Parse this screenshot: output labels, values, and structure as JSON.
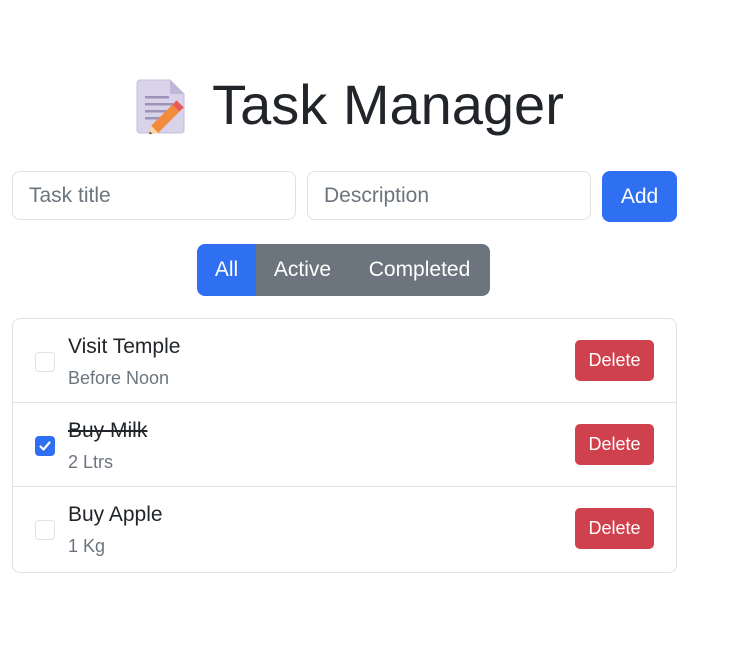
{
  "header": {
    "icon": "memo-icon",
    "title": "Task Manager"
  },
  "form": {
    "title_placeholder": "Task title",
    "description_placeholder": "Description",
    "add_label": "Add"
  },
  "filters": [
    {
      "label": "All",
      "active": true
    },
    {
      "label": "Active",
      "active": false
    },
    {
      "label": "Completed",
      "active": false
    }
  ],
  "tasks": [
    {
      "title": "Visit Temple",
      "description": "Before Noon",
      "completed": false,
      "delete_label": "Delete"
    },
    {
      "title": "Buy Milk",
      "description": "2 Ltrs",
      "completed": true,
      "delete_label": "Delete"
    },
    {
      "title": "Buy Apple",
      "description": "1 Kg",
      "completed": false,
      "delete_label": "Delete"
    }
  ],
  "colors": {
    "primary": "#2f6ff2",
    "secondary": "#6c757d",
    "danger": "#d0414e",
    "border": "#dee2e6"
  }
}
